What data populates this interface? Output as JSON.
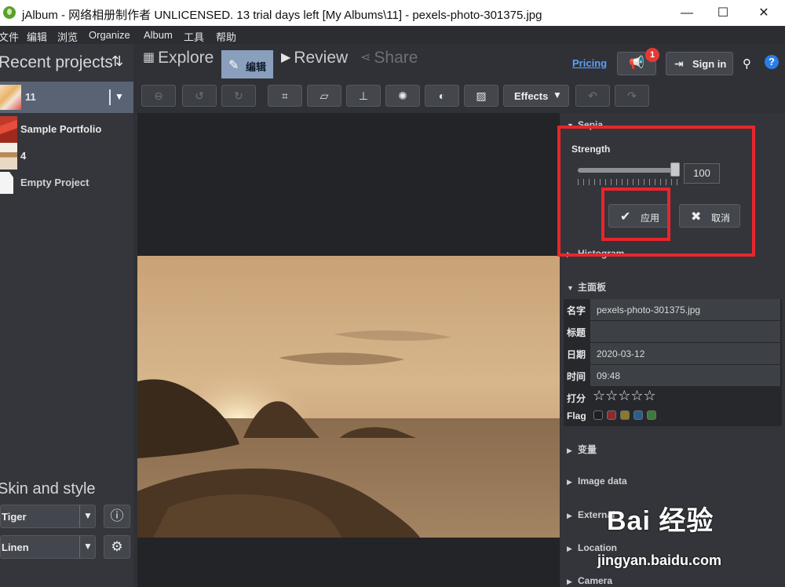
{
  "window": {
    "title": "jAlbum - 网络相册制作者 UNLICENSED. 13 trial days left [My Albums\\11] - pexels-photo-301375.jpg",
    "minimize": "—",
    "maximize": "☐",
    "close": "✕"
  },
  "menubar": [
    "文件",
    "编辑",
    "浏览",
    "Organize",
    "Album",
    "工具",
    "帮助"
  ],
  "left": {
    "recent_title": "Recent projects",
    "sort_icon": "⇅",
    "projects": [
      {
        "label": "11",
        "icon": "project-thumbnail"
      },
      {
        "label": "Sample Portfolio",
        "icon": "project-thumbnail"
      },
      {
        "label": "4",
        "icon": "project-thumbnail"
      },
      {
        "label": "Empty Project",
        "icon": "blank-page-icon"
      }
    ],
    "skin_title": "Skin and style",
    "skin": "Tiger",
    "style": "Linen",
    "info_icon": "ⓘ",
    "gear_icon": "⚙",
    "dropdown_arrow": "▼"
  },
  "nav": {
    "explore": "Explore",
    "edit": "编辑",
    "review": "Review",
    "share": "Share",
    "pricing": "Pricing",
    "announce_badge": "1",
    "signin": "Sign in",
    "help": "?"
  },
  "toolbar": {
    "effects": "Effects",
    "effects_arrow": "▼"
  },
  "panel": {
    "sepia_title": "Sepia",
    "strength_label": "Strength",
    "strength_value": "100",
    "strength_fraction": 1.0,
    "apply": "应用",
    "cancel": "取消",
    "histogram": "Histogram",
    "main_panel": "主面板",
    "meta": [
      {
        "key": "名字",
        "value": "pexels-photo-301375.jpg"
      },
      {
        "key": "标题",
        "value": ""
      },
      {
        "key": "日期",
        "value": "2020-03-12"
      },
      {
        "key": "时间",
        "value": "09:48"
      }
    ],
    "rating_label": "打分",
    "rating_stars": "☆☆☆☆☆",
    "flag_label": "Flag",
    "flag_colors": [
      "#1e1f22",
      "#8b2c2c",
      "#8a7a2a",
      "#2c5e8b",
      "#3d7a3a"
    ],
    "sections": [
      "变量",
      "Image data",
      "External",
      "Location",
      "Camera"
    ]
  },
  "watermark": {
    "brand": "Bai 经验",
    "url": "jingyan.baidu.com"
  },
  "colors": {
    "accent_blue": "#5aa0ff",
    "highlight_red": "#e8262d",
    "edit_tab": "#8a9fbd"
  }
}
